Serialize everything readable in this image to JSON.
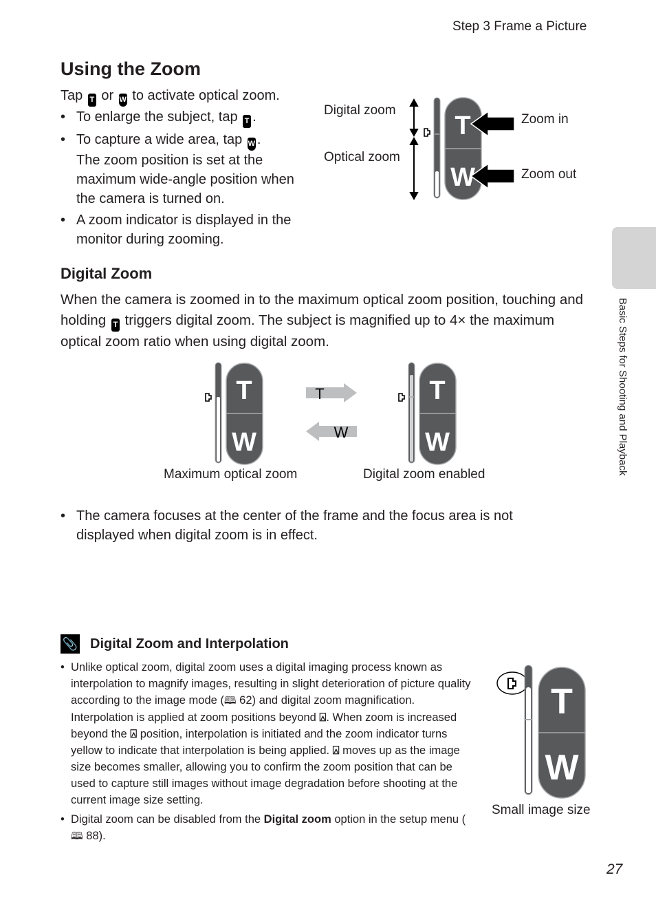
{
  "header": {
    "running_head": "Step 3 Frame a Picture",
    "page_number": "27",
    "side_tab_label": "Basic Steps for Shooting and Playback"
  },
  "section_zoom": {
    "title": "Using the Zoom",
    "intro": {
      "before": "Tap ",
      "icon1": "T",
      "middle": " or ",
      "icon2": "W",
      "after": " to activate optical zoom."
    },
    "bullets": [
      {
        "text": "To enlarge the subject, tap ",
        "icon": "T",
        "after": "."
      },
      {
        "text": "To capture a wide area, tap ",
        "icon": "W",
        "after": ".",
        "extra": "The zoom position is set at the maximum wide-angle position when the camera is turned on."
      },
      {
        "text": "A zoom indicator is displayed in the monitor during zooming."
      }
    ],
    "diagram": {
      "label_digital": "Digital zoom",
      "label_optical": "Optical zoom",
      "label_zoom_in": "Zoom in",
      "label_zoom_out": "Zoom out",
      "btn_t": "T",
      "btn_w": "W"
    }
  },
  "section_digital": {
    "title": "Digital Zoom",
    "para": {
      "before": "When the camera is zoomed in to the maximum optical zoom position, touching and holding ",
      "icon": "T",
      "after": " triggers digital zoom. The subject is magnified up to 4× the maximum optical zoom ratio when using digital zoom."
    },
    "diagram": {
      "caption_left": "Maximum optical zoom",
      "caption_right": "Digital zoom enabled",
      "arrow_right_label": "T",
      "arrow_left_label": "W",
      "btn_t": "T",
      "btn_w": "W"
    },
    "bullet": "The camera focuses at the center of the frame and the focus area is not displayed when digital zoom is in effect."
  },
  "note": {
    "icon": "paperclip-icon",
    "title": "Digital Zoom and Interpolation",
    "item1": {
      "p1_before": "Unlike optical zoom, digital zoom uses a digital imaging process known as interpolation to magnify images, resulting in slight deterioration of picture quality according to the image mode (",
      "p1_book": "🕮",
      "p1_ref": " 62) and digital zoom magnification.",
      "p2_a": "Interpolation is applied at zoom positions beyond ",
      "p2_b": ". When zoom is increased beyond the ",
      "p2_c": " position, interpolation is initiated and the zoom indicator turns yellow to indicate that interpolation is being applied. ",
      "p2_d": " moves up as the image size becomes smaller, allowing you to confirm the zoom position that can be used to capture still images without image degradation before shooting at the current image size setting."
    },
    "item2": {
      "before": "Digital zoom can be disabled from the ",
      "bold": "Digital zoom",
      "after": " option in the setup menu (",
      "ref": " 88)."
    },
    "figure_caption": "Small image size",
    "btn_t": "T",
    "btn_w": "W"
  },
  "colors": {
    "button_fill": "#58595b",
    "button_border": "#a7a9ac",
    "side_tab": "#d4d4d4",
    "arrow_grey": "#bcbec0",
    "text": "#231f20"
  }
}
